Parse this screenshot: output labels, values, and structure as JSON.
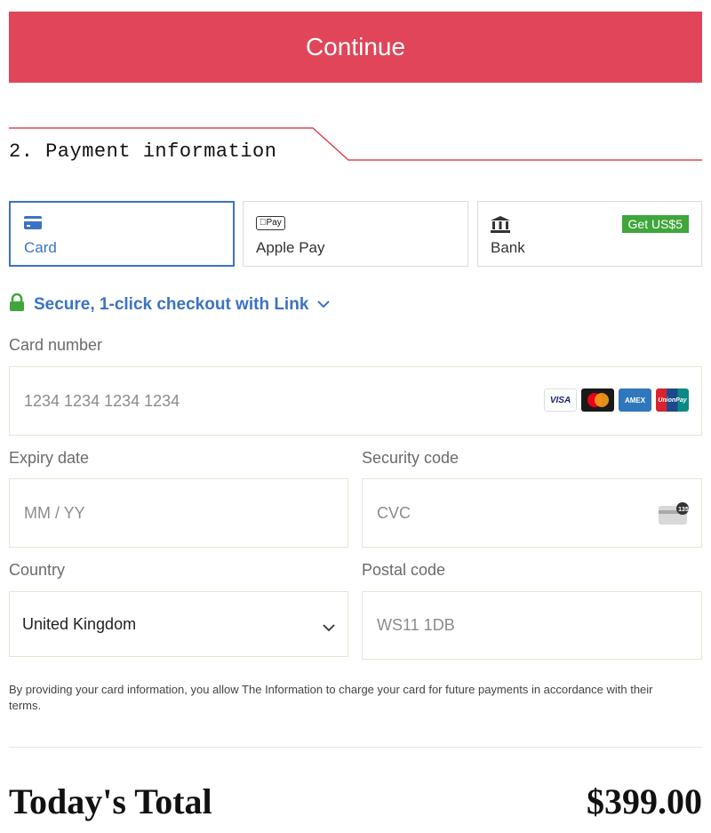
{
  "continue_label": "Continue",
  "section": {
    "title": "2. Payment information",
    "accent_color": "#e0455a"
  },
  "payment_methods": [
    {
      "label": "Card",
      "icon": "credit-card-icon",
      "selected": true
    },
    {
      "label": "Apple Pay",
      "icon": "apple-pay-icon",
      "icon_text": "Pay",
      "selected": false
    },
    {
      "label": "Bank",
      "icon": "bank-icon",
      "selected": false,
      "badge": "Get US$5"
    }
  ],
  "link": {
    "text": "Secure, 1-click checkout with Link",
    "icon": "lock-icon",
    "chevron": "chevron-down-icon"
  },
  "card_number": {
    "label": "Card number",
    "placeholder": "1234 1234 1234 1234",
    "brands": [
      "VISA",
      "Mastercard",
      "AMEX",
      "UnionPay"
    ]
  },
  "expiry": {
    "label": "Expiry date",
    "placeholder": "MM / YY"
  },
  "security": {
    "label": "Security code",
    "placeholder": "CVC",
    "icon": "cvc-card-icon",
    "icon_text": "135"
  },
  "country": {
    "label": "Country",
    "value": "United Kingdom"
  },
  "postal": {
    "label": "Postal code",
    "placeholder": "WS11 1DB"
  },
  "terms": "By providing your card information, you allow The Information to charge your card for future payments in accordance with their terms.",
  "total": {
    "label": "Today's Total",
    "value": "$399.00"
  },
  "colors": {
    "link_blue": "#3b73c4",
    "badge_green": "#3ea63a",
    "lock_green": "#3ea63a"
  }
}
